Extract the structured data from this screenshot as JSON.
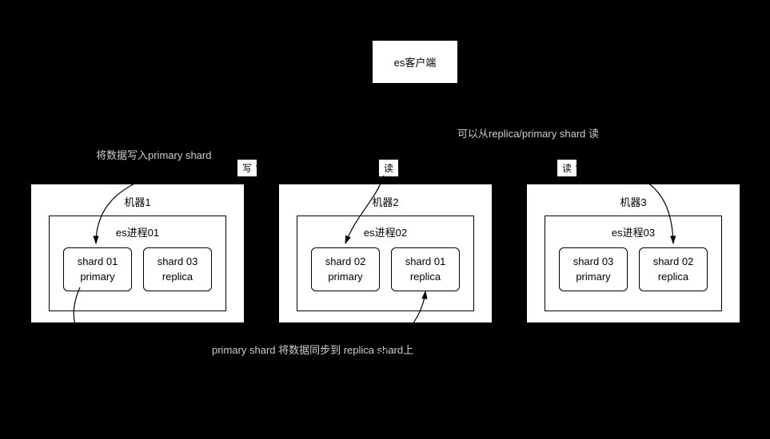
{
  "client": {
    "label": "es客户端"
  },
  "machines": [
    {
      "title": "机器1",
      "process": "es进程01",
      "shards": [
        {
          "name": "shard 01",
          "role": "primary"
        },
        {
          "name": "shard 03",
          "role": "replica"
        }
      ]
    },
    {
      "title": "机器2",
      "process": "es进程02",
      "shards": [
        {
          "name": "shard 02",
          "role": "primary"
        },
        {
          "name": "shard 01",
          "role": "replica"
        }
      ]
    },
    {
      "title": "机器3",
      "process": "es进程03",
      "shards": [
        {
          "name": "shard 03",
          "role": "primary"
        },
        {
          "name": "shard 02",
          "role": "replica"
        }
      ]
    }
  ],
  "edges": {
    "write": "写",
    "read": "读"
  },
  "annotations": {
    "write_note": "将数据写入primary shard",
    "read_note": "可以从replica/primary shard 读",
    "sync_note": "primary shard 将数据同步到 replica shard上"
  }
}
